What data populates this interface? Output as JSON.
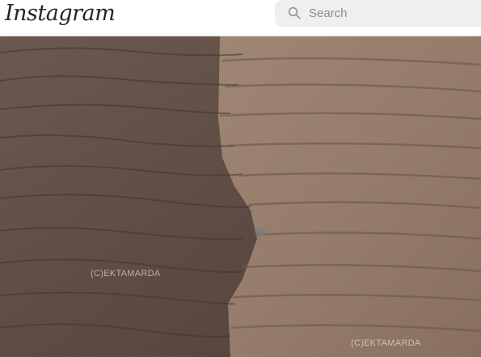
{
  "header": {
    "logo_text": "Instagram",
    "search": {
      "placeholder": "Search",
      "value": "",
      "icon": "search-icon"
    }
  },
  "photo": {
    "watermark_left": "(C)EKTAMARDA",
    "watermark_right": "(C)EKTAMARDA"
  },
  "colors": {
    "header_bg": "#ffffff",
    "search_bg": "#efefef",
    "rock_dark": "#5b4a42",
    "rock_light": "#a88c77"
  }
}
